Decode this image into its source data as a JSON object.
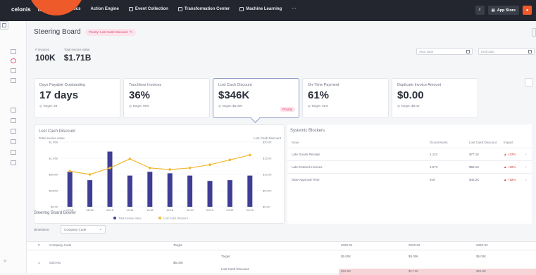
{
  "topbar": {
    "logo": "celonis",
    "nav": [
      "Process Analytics",
      "Action Engine",
      "Event Collection",
      "Transformation Center",
      "Machine Learning",
      "⋯"
    ],
    "app_store": "App Store"
  },
  "header": {
    "title": "Steering Board",
    "tag": "Priority: Lost Cash Discount"
  },
  "stats": [
    {
      "label": "# invoices",
      "value": "100K"
    },
    {
      "label": "Total invoice value",
      "value": "$1.71B"
    }
  ],
  "filters": {
    "start_placeholder": "Start Date",
    "end_placeholder": "End Date"
  },
  "kpis": [
    {
      "label": "Days Payable Outstanding",
      "value": "17 days",
      "target": "Target: 29",
      "badge": ""
    },
    {
      "label": "Touchless Invoices",
      "value": "36%",
      "target": "Target: 86%",
      "badge": ""
    },
    {
      "label": "Lost Cash Discount",
      "value": "$346K",
      "target": "Target: $5.00K",
      "badge": "Priority"
    },
    {
      "label": "On-Time Payment",
      "value": "61%",
      "target": "Target: 92%",
      "badge": ""
    },
    {
      "label": "Duplicate Invoice Amount",
      "value": "$0.00",
      "target": "Target: $0.00",
      "badge": ""
    }
  ],
  "chart_panel_title": "Lost Cash Discount",
  "chart_data": {
    "type": "bar",
    "title": "Lost Cash Discount",
    "ylabel_left": "Total invoice value",
    "ylabel_right": "Lost Cash Discount",
    "categories": [
      "07/18",
      "08/18",
      "09/18",
      "10/18",
      "11/18",
      "12/18",
      "01/19",
      "02/19",
      "03/19",
      "04/19"
    ],
    "left_ticks": [
      "$1.50B",
      "$1.00B",
      "$500M",
      "$250M",
      "$0.00"
    ],
    "right_ticks": [
      "$20.0K",
      "$15.0K",
      "$10.0K",
      "$5.00K",
      "$0.00"
    ],
    "series": [
      {
        "name": "Total invoice value",
        "kind": "bar",
        "color": "#3f3d96",
        "values": [
          0.92,
          0.7,
          1.45,
          0.82,
          0.92,
          0.88,
          0.82,
          0.68,
          0.7,
          0.82
        ]
      },
      {
        "name": "Lost Cash Discount",
        "kind": "line",
        "color": "#f2b830",
        "values": [
          11.0,
          10.0,
          12.0,
          14.8,
          12.0,
          11.5,
          12.0,
          13.0,
          14.5,
          16.0
        ]
      }
    ],
    "ylim_left": [
      0,
      1.7
    ],
    "ylim_right": [
      0,
      20
    ],
    "legend": "bottom"
  },
  "blockers": {
    "title": "Systemic Blockers",
    "columns": [
      "Issue",
      "Occurrences",
      "Lost Cash Discount",
      "Impact"
    ],
    "rows": [
      {
        "issue": "Late Goods Receipt",
        "occ": "1,112",
        "lcd": "$77.1K",
        "impact": "+22%"
      },
      {
        "issue": "Late Entered Invoices",
        "occ": "2,573",
        "lcd": "$58.1K",
        "impact": "+20%"
      },
      {
        "issue": "Slow Approval Time",
        "occ": "819",
        "lcd": "$45.2K",
        "impact": "+18%"
      }
    ]
  },
  "board": {
    "title": "Steering Board Bowler",
    "dimension_label": "Dimension:",
    "dimension_value": "Company Code",
    "columns": [
      "#",
      "Company Code",
      "Target"
    ],
    "row": {
      "num": "1",
      "code": "CE0 AG",
      "target": "$5.00K"
    },
    "sub_rows": [
      "Target",
      "Lost Cash Discount"
    ],
    "periods": [
      "2020-01",
      "2020-02",
      "2020-03"
    ],
    "targets": [
      "$5.00K",
      "$5.00K",
      "$5.00K"
    ],
    "actuals": [
      "$22.5K",
      "$17.3K",
      "$22.6K"
    ]
  }
}
